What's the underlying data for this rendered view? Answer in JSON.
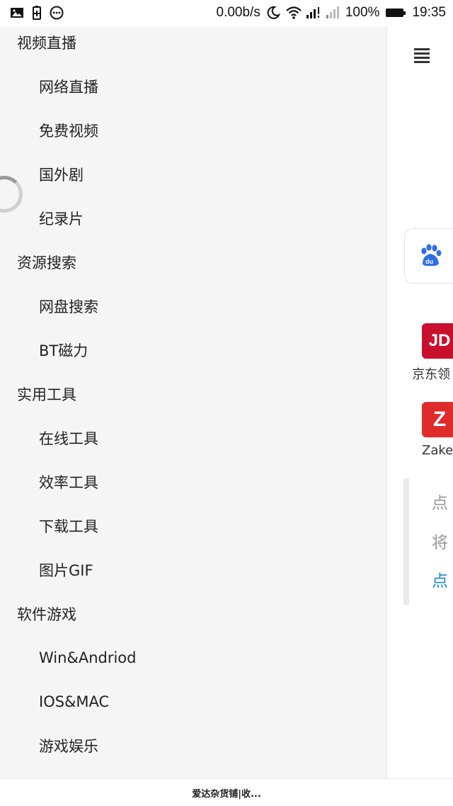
{
  "status_bar": {
    "speed": "0.00b/s",
    "battery": "100%",
    "time": "19:35",
    "icons": [
      "image-icon",
      "battery-plus-icon",
      "more-dots-icon",
      "moon-icon",
      "wifi-icon",
      "signal-icon",
      "signal-weak-icon",
      "battery-icon"
    ]
  },
  "drawer": {
    "items": [
      {
        "label": "视频直播",
        "level": "top"
      },
      {
        "label": "网络直播",
        "level": "sub"
      },
      {
        "label": "免费视频",
        "level": "sub"
      },
      {
        "label": "国外剧",
        "level": "sub"
      },
      {
        "label": "纪录片",
        "level": "sub"
      },
      {
        "label": "资源搜索",
        "level": "top"
      },
      {
        "label": "网盘搜索",
        "level": "sub"
      },
      {
        "label": "BT磁力",
        "level": "sub"
      },
      {
        "label": "实用工具",
        "level": "top"
      },
      {
        "label": "在线工具",
        "level": "sub"
      },
      {
        "label": "效率工具",
        "level": "sub"
      },
      {
        "label": "下载工具",
        "level": "sub"
      },
      {
        "label": "图片GIF",
        "level": "sub"
      },
      {
        "label": "软件游戏",
        "level": "top"
      },
      {
        "label": "Win&Andriod",
        "level": "sub"
      },
      {
        "label": "IOS&MAC",
        "level": "sub"
      },
      {
        "label": "游戏娱乐",
        "level": "sub"
      }
    ]
  },
  "content": {
    "tiles": [
      {
        "icon_text": "JD",
        "label": "京东领"
      },
      {
        "icon_text": "Z",
        "label": "Zaker"
      }
    ],
    "note_lines": [
      "点",
      "将",
      "点"
    ]
  },
  "bottom_bar": {
    "title": "爱达杂货铺|收..."
  },
  "colors": {
    "drawer_bg": "#f5f5f5",
    "link_blue": "#1a8ad6",
    "jd_red": "#c8102e",
    "zaker_red": "#e02b2b"
  }
}
